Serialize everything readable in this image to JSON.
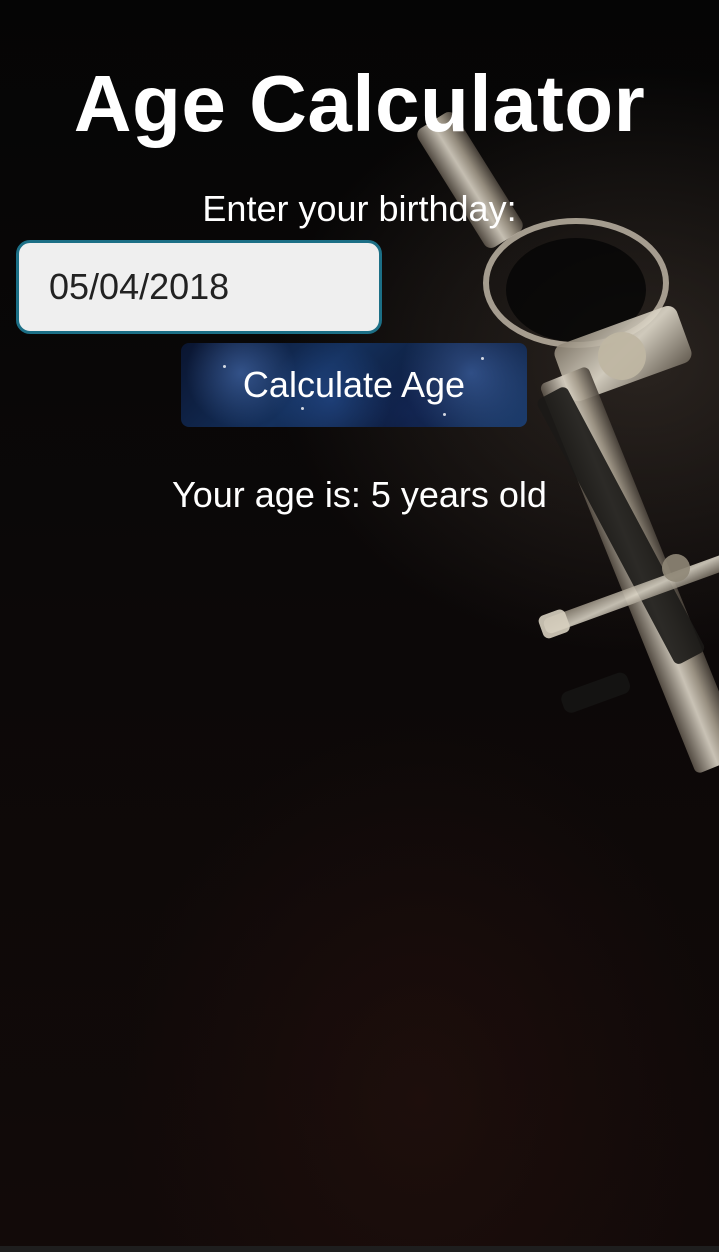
{
  "app": {
    "title": "Age Calculator",
    "prompt": "Enter your birthday:",
    "birthday_value": "05/04/2018",
    "calculate_label": "Calculate Age",
    "result_text": "Your age is: 5 years old"
  },
  "background": {
    "image_subject": "drawing-compass-icon"
  },
  "colors": {
    "input_border": "#1c6f86",
    "input_background": "#efefef",
    "text": "#ffffff"
  }
}
